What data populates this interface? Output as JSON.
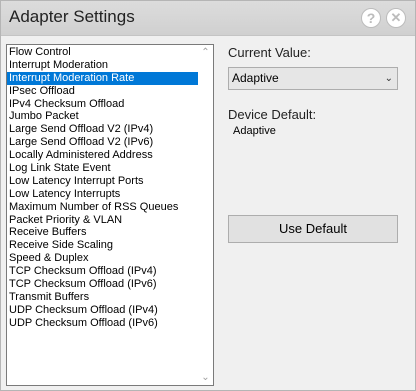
{
  "window": {
    "title": "Adapter Settings",
    "help_glyph": "?",
    "close_glyph": "✕"
  },
  "properties": {
    "items": [
      {
        "label": "Flow Control"
      },
      {
        "label": "Interrupt Moderation"
      },
      {
        "label": "Interrupt Moderation Rate",
        "selected": true
      },
      {
        "label": "IPsec Offload"
      },
      {
        "label": "IPv4 Checksum Offload"
      },
      {
        "label": "Jumbo Packet"
      },
      {
        "label": "Large Send Offload V2 (IPv4)"
      },
      {
        "label": "Large Send Offload V2 (IPv6)"
      },
      {
        "label": "Locally Administered Address"
      },
      {
        "label": "Log Link State Event"
      },
      {
        "label": "Low Latency Interrupt Ports"
      },
      {
        "label": "Low Latency Interrupts"
      },
      {
        "label": "Maximum Number of RSS Queues"
      },
      {
        "label": "Packet Priority & VLAN"
      },
      {
        "label": "Receive Buffers"
      },
      {
        "label": "Receive Side Scaling"
      },
      {
        "label": "Speed & Duplex"
      },
      {
        "label": "TCP Checksum Offload (IPv4)"
      },
      {
        "label": "TCP Checksum Offload (IPv6)"
      },
      {
        "label": "Transmit Buffers"
      },
      {
        "label": "UDP Checksum Offload (IPv4)"
      },
      {
        "label": "UDP Checksum Offload (IPv6)"
      }
    ],
    "scroll_up_glyph": "⌃",
    "scroll_down_glyph": "⌄"
  },
  "current": {
    "label": "Current Value:",
    "value": "Adaptive",
    "dropdown_glyph": "⌄"
  },
  "default": {
    "label": "Device Default:",
    "value": "Adaptive"
  },
  "actions": {
    "use_default_label": "Use Default"
  },
  "colors": {
    "selection": "#0078d7"
  }
}
